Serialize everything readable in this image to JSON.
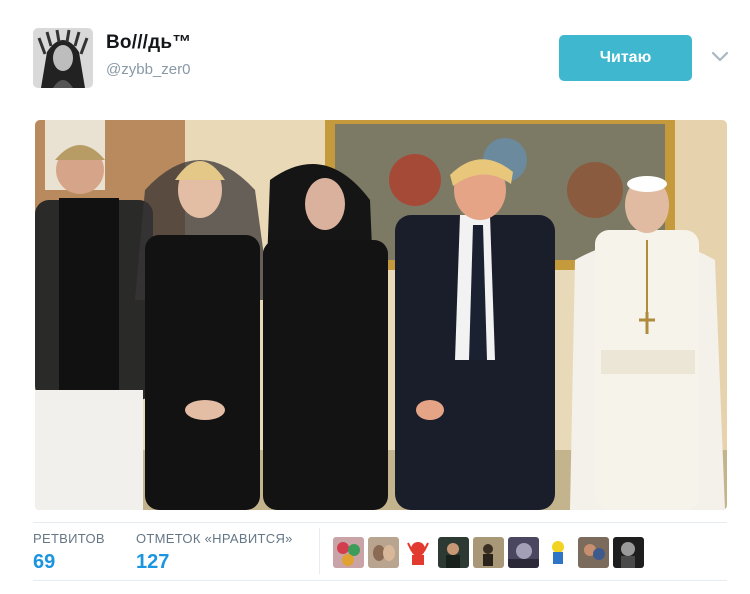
{
  "tweet": {
    "display_name": "Во///дь™",
    "handle": "@zybb_zer0",
    "follow_label": "Читаю"
  },
  "stats": {
    "retweets_label": "РЕТВИТОВ",
    "retweets_value": "69",
    "likes_label": "ОТМЕТОК «НРАВИТСЯ»",
    "likes_value": "127"
  },
  "icons": {
    "more": "chevron-down-icon"
  },
  "colors": {
    "follow_button": "#3fb8cf",
    "stat_value": "#1b95e0",
    "stat_label": "#657786",
    "handle": "#8899a6"
  }
}
